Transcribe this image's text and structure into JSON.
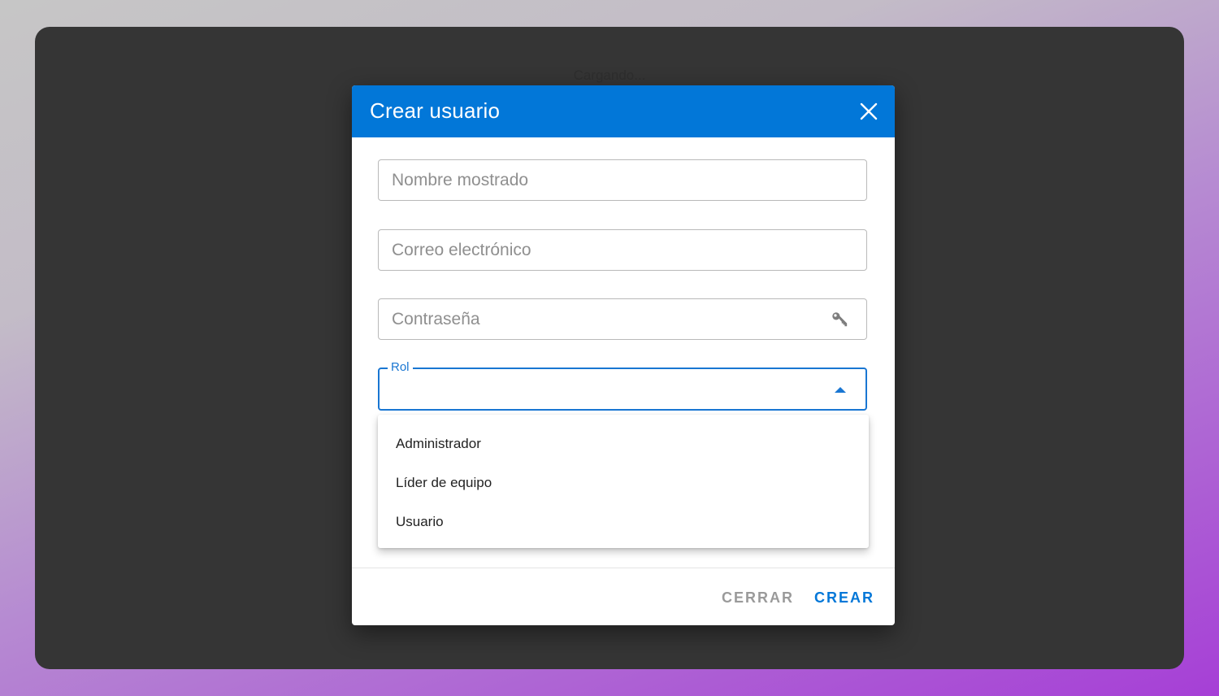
{
  "background_text": "Cargando...",
  "dialog": {
    "title": "Crear usuario",
    "close_icon": "close-icon",
    "fields": {
      "display_name_placeholder": "Nombre mostrado",
      "email_placeholder": "Correo electrónico",
      "password_placeholder": "Contraseña",
      "password_icon": "key-icon"
    },
    "role": {
      "label": "Rol",
      "value": "",
      "options": [
        "Administrador",
        "Líder de equipo",
        "Usuario"
      ]
    },
    "actions": {
      "close_label": "CERRAR",
      "create_label": "CREAR"
    }
  },
  "colors": {
    "header": "#0277d8",
    "accent": "#1976d2",
    "overlay": "#353535"
  }
}
